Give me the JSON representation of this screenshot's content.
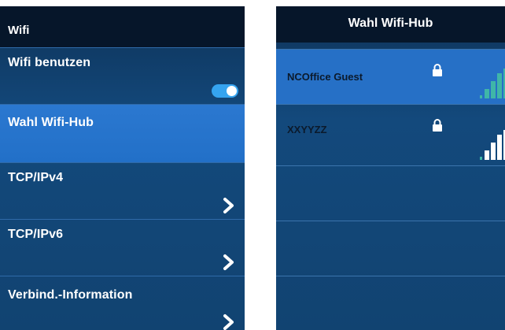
{
  "wifi_panel": {
    "title": "Wifi",
    "items": [
      {
        "label": "Wifi benutzen",
        "control": "toggle",
        "toggle_on": true
      },
      {
        "label": "Wahl Wifi-Hub",
        "control": "none",
        "selected": true
      },
      {
        "label": "TCP/IPv4",
        "control": "chevron-right-icon"
      },
      {
        "label": "TCP/IPv6",
        "control": "chevron-right-icon"
      },
      {
        "label": "Verbind.-Information",
        "control": "chevron-right-icon"
      }
    ]
  },
  "hub_panel": {
    "title": "Wahl Wifi-Hub",
    "networks": [
      {
        "ssid": "NCOffice Guest",
        "secured": true,
        "icon": "lock-icon",
        "signal_icon": "wifi-signal-icon",
        "selected": true
      },
      {
        "ssid": "XXYYZZ",
        "secured": true,
        "icon": "lock-icon",
        "signal_icon": "wifi-signal-icon",
        "selected": false
      }
    ]
  },
  "colors": {
    "header_bg": "#06162a",
    "panel_bg": "#13497c",
    "selected_row": "#2670c6",
    "toggle_on": "#35a4f0",
    "signal_bar": "#3fb6a8"
  }
}
